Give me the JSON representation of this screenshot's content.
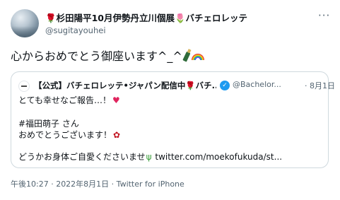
{
  "author": {
    "display_name": "🌹杉田陽平10月伊勢丹立川個展🌷バチェロレッテ",
    "handle": "@sugitayouhei"
  },
  "tweet": {
    "text": "心からおめでとう御座います^_^"
  },
  "quoted": {
    "display_name": "【公式】バチェロレッテ•ジャパン配信中🌹バチ...",
    "handle": "@Bachelor...",
    "date": "· 8月1日",
    "line1": "とても幸せなご報告…！",
    "line2": "#福田萌子 さん",
    "line3": "おめでとうございます！",
    "line4_text": "どうかお身体ご自愛くださいませ",
    "line4_link": "twitter.com/moekofukuda/st..."
  },
  "meta": {
    "timestamp": "午後10:27 · 2022年8月1日 · Twitter for iPhone"
  },
  "icons": [
    "more-icon",
    "champagne-icon",
    "rainbow-icon",
    "verified-badge-icon",
    "heart-icon",
    "rose-icon",
    "sprout-icon"
  ],
  "colors": {
    "accent": "#1d9bf0",
    "secondary_text": "#536471",
    "border": "#cfd9de"
  }
}
